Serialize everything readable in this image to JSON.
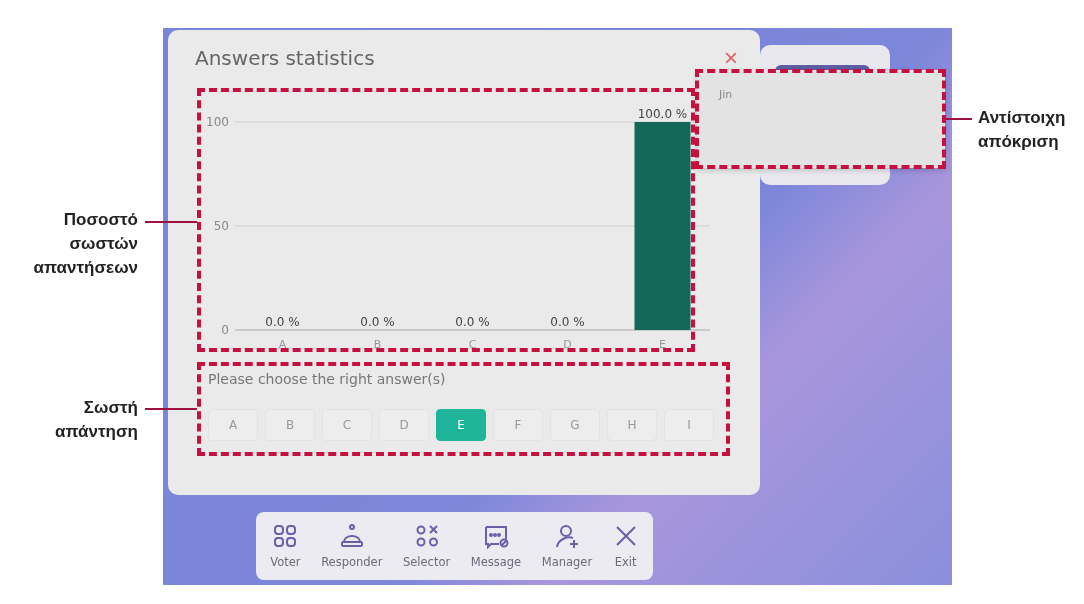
{
  "dialog": {
    "title": "Answers statistics",
    "close": "×",
    "chart_data": {
      "type": "bar",
      "categories": [
        "A",
        "B",
        "C",
        "D",
        "E"
      ],
      "values": [
        0,
        0,
        0,
        0,
        100
      ],
      "ylim": [
        0,
        100
      ],
      "yticks": [
        0,
        50,
        100
      ],
      "value_labels": [
        "0.0 %",
        "0.0 %",
        "0.0 %",
        "0.0 %",
        "100.0 %"
      ]
    },
    "prompt": "Please choose the right answer(s)",
    "answers": [
      {
        "label": "A",
        "selected": false
      },
      {
        "label": "B",
        "selected": false
      },
      {
        "label": "C",
        "selected": false
      },
      {
        "label": "D",
        "selected": false
      },
      {
        "label": "E",
        "selected": true
      },
      {
        "label": "F",
        "selected": false
      },
      {
        "label": "G",
        "selected": false
      },
      {
        "label": "H",
        "selected": false
      },
      {
        "label": "I",
        "selected": false
      }
    ]
  },
  "response_popup": {
    "names": [
      "Jin"
    ]
  },
  "toolbar": [
    {
      "label": "Voter",
      "kind": "voter"
    },
    {
      "label": "Responder",
      "kind": "responder"
    },
    {
      "label": "Selector",
      "kind": "selector"
    },
    {
      "label": "Message",
      "kind": "message"
    },
    {
      "label": "Manager",
      "kind": "manager"
    },
    {
      "label": "Exit",
      "kind": "exit"
    }
  ],
  "annotations": {
    "chart": "Ποσοστό σωστών απαντήσεων",
    "answers": "Σωστή απάντηση",
    "response": "Αντίστοιχη απόκριση"
  }
}
